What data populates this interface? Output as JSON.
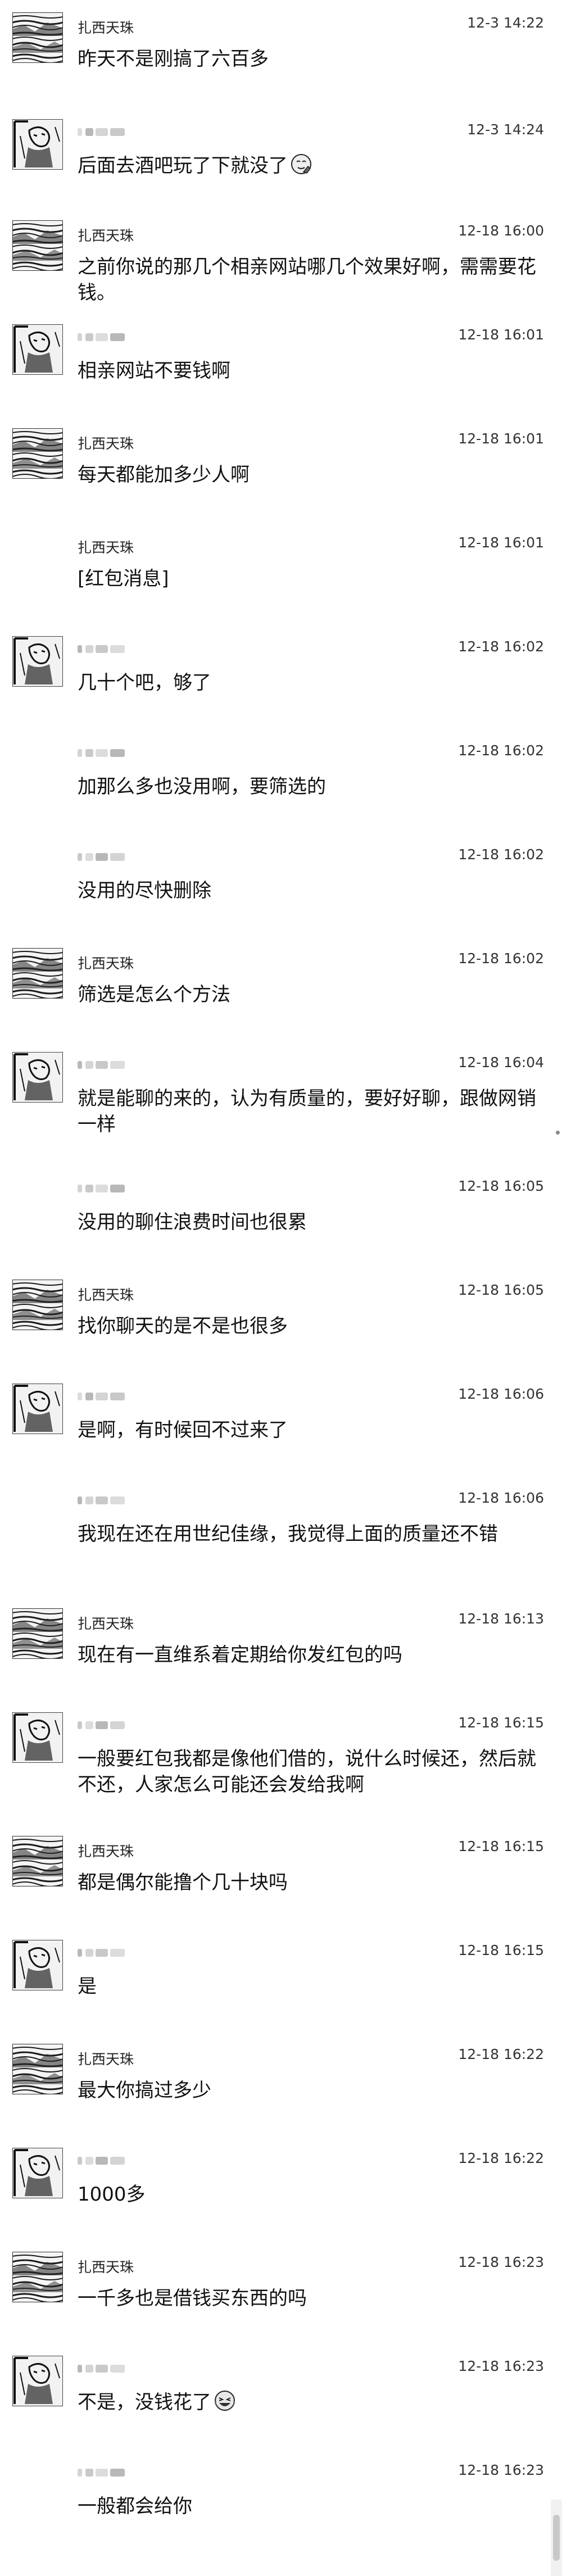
{
  "messages": [
    {
      "sender": "扎西天珠",
      "sender_kind": "named",
      "avatar": "landscape",
      "time": "12-3 14:22",
      "text": "昨天不是刚搞了六百多",
      "emoji": ""
    },
    {
      "sender": "",
      "sender_kind": "redacted",
      "avatar": "figure",
      "time": "12-3 14:24",
      "text": "后面去酒吧玩了下就没了",
      "emoji": "face-with-hand-icon"
    },
    {
      "sender": "扎西天珠",
      "sender_kind": "named",
      "avatar": "landscape",
      "time": "12-18 16:00",
      "text": "之前你说的那几个相亲网站哪几个效果好啊，需需要花钱。",
      "emoji": ""
    },
    {
      "sender": "",
      "sender_kind": "redacted",
      "avatar": "figure",
      "time": "12-18 16:01",
      "text": "相亲网站不要钱啊",
      "emoji": ""
    },
    {
      "sender": "扎西天珠",
      "sender_kind": "named",
      "avatar": "landscape",
      "time": "12-18 16:01",
      "text": "每天都能加多少人啊",
      "emoji": ""
    },
    {
      "sender": "扎西天珠",
      "sender_kind": "named",
      "avatar": "none",
      "time": "12-18 16:01",
      "text": "[红包消息]",
      "emoji": ""
    },
    {
      "sender": "",
      "sender_kind": "redacted",
      "avatar": "figure",
      "time": "12-18 16:02",
      "text": "几十个吧，够了",
      "emoji": ""
    },
    {
      "sender": "",
      "sender_kind": "redacted",
      "avatar": "none",
      "time": "12-18 16:02",
      "text": "加那么多也没用啊，要筛选的",
      "emoji": ""
    },
    {
      "sender": "",
      "sender_kind": "redacted",
      "avatar": "none",
      "time": "12-18 16:02",
      "text": "没用的尽快删除",
      "emoji": ""
    },
    {
      "sender": "扎西天珠",
      "sender_kind": "named",
      "avatar": "landscape",
      "time": "12-18 16:02",
      "text": "筛选是怎么个方法",
      "emoji": ""
    },
    {
      "sender": "",
      "sender_kind": "redacted",
      "avatar": "figure",
      "time": "12-18 16:04",
      "text": "就是能聊的来的，认为有质量的，要好好聊，跟做网销一样",
      "emoji": ""
    },
    {
      "sender": "",
      "sender_kind": "redacted",
      "avatar": "none",
      "time": "12-18 16:05",
      "text": "没用的聊住浪费时间也很累",
      "emoji": ""
    },
    {
      "sender": "扎西天珠",
      "sender_kind": "named",
      "avatar": "landscape",
      "time": "12-18 16:05",
      "text": "找你聊天的是不是也很多",
      "emoji": ""
    },
    {
      "sender": "",
      "sender_kind": "redacted",
      "avatar": "figure",
      "time": "12-18 16:06",
      "text": "是啊，有时候回不过来了",
      "emoji": ""
    },
    {
      "sender": "",
      "sender_kind": "redacted",
      "avatar": "none",
      "time": "12-18 16:06",
      "text": "我现在还在用世纪佳缘，我觉得上面的质量还不错",
      "emoji": ""
    },
    {
      "sender": "扎西天珠",
      "sender_kind": "named",
      "avatar": "landscape",
      "time": "12-18 16:13",
      "text": "现在有一直维系着定期给你发红包的吗",
      "emoji": ""
    },
    {
      "sender": "",
      "sender_kind": "redacted",
      "avatar": "figure",
      "time": "12-18 16:15",
      "text": "一般要红包我都是像他们借的，说什么时候还，然后就不还，人家怎么可能还会发给我啊",
      "emoji": ""
    },
    {
      "sender": "扎西天珠",
      "sender_kind": "named",
      "avatar": "landscape",
      "time": "12-18 16:15",
      "text": "都是偶尔能撸个几十块吗",
      "emoji": ""
    },
    {
      "sender": "",
      "sender_kind": "redacted",
      "avatar": "figure",
      "time": "12-18 16:15",
      "text": "是",
      "emoji": ""
    },
    {
      "sender": "扎西天珠",
      "sender_kind": "named",
      "avatar": "landscape",
      "time": "12-18 16:22",
      "text": "最大你搞过多少",
      "emoji": ""
    },
    {
      "sender": "",
      "sender_kind": "redacted",
      "avatar": "figure",
      "time": "12-18 16:22",
      "text": "1000多",
      "emoji": ""
    },
    {
      "sender": "扎西天珠",
      "sender_kind": "named",
      "avatar": "landscape",
      "time": "12-18 16:23",
      "text": "一千多也是借钱买东西的吗",
      "emoji": ""
    },
    {
      "sender": "",
      "sender_kind": "redacted",
      "avatar": "figure",
      "time": "12-18 16:23",
      "text": "不是，没钱花了",
      "emoji": "laughing-face-icon"
    },
    {
      "sender": "",
      "sender_kind": "redacted",
      "avatar": "none",
      "time": "12-18 16:23",
      "text": "一般都会给你",
      "emoji": ""
    }
  ]
}
